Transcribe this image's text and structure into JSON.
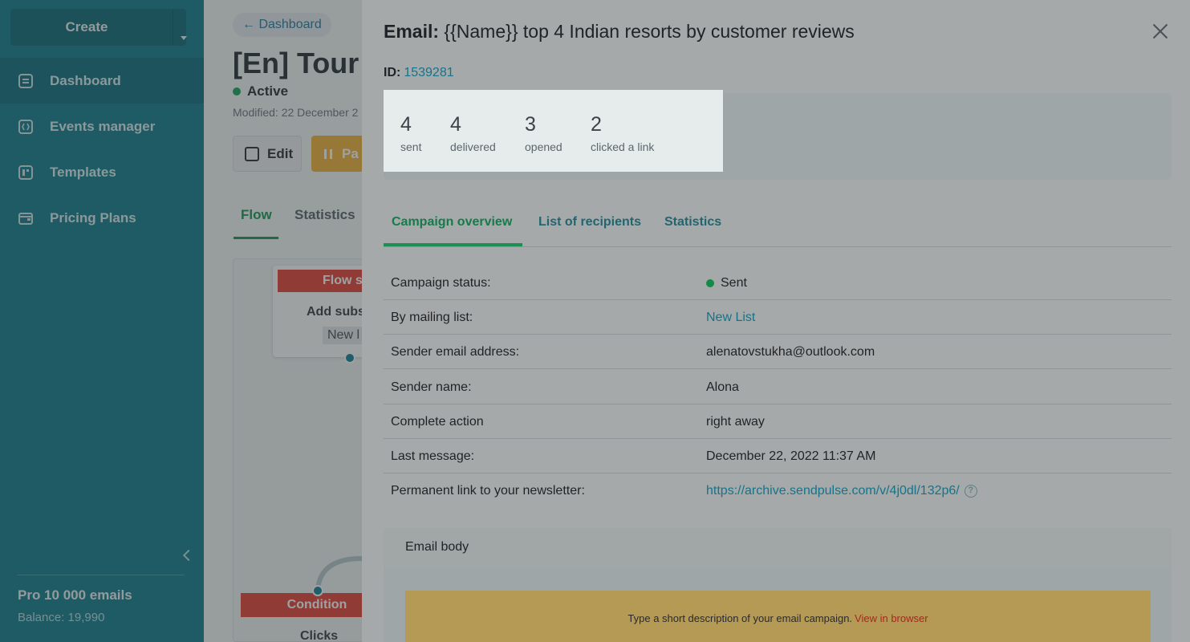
{
  "sidebar": {
    "create_label": "Create",
    "nav": [
      {
        "label": "Dashboard",
        "icon": "dashboard-icon"
      },
      {
        "label": "Events manager",
        "icon": "events-icon"
      },
      {
        "label": "Templates",
        "icon": "templates-icon"
      },
      {
        "label": "Pricing Plans",
        "icon": "wallet-icon"
      }
    ],
    "plan_name": "Pro 10 000 emails",
    "balance": "Balance: 19,990"
  },
  "background": {
    "back_link": "← Dashboard",
    "title": "[En] Tour",
    "status": "Active",
    "modified": "Modified: 22 December 2",
    "edit_label": "Edit",
    "pause_label": "Pa",
    "tabs": [
      "Flow",
      "Statistics"
    ],
    "flow_header": "Flow s",
    "flow_text": "Add subs",
    "flow_chip": "New l",
    "condition_header": "Condition",
    "condition_sub": "Clicks"
  },
  "modal": {
    "title_prefix": "Email:",
    "title": "{{Name}} top 4 Indian resorts by customer reviews",
    "id_label": "ID:",
    "id_value": "1539281",
    "stats": [
      {
        "num": "4",
        "label": "sent"
      },
      {
        "num": "4",
        "label": "delivered"
      },
      {
        "num": "3",
        "label": "opened"
      },
      {
        "num": "2",
        "label": "clicked a link"
      }
    ],
    "tabs": [
      "Campaign overview",
      "List of recipients",
      "Statistics"
    ],
    "rows": [
      {
        "key": "Campaign status:",
        "value": "Sent"
      },
      {
        "key": "By mailing list:",
        "value": "New List"
      },
      {
        "key": "Sender email address:",
        "value": "alenatovstukha@outlook.com"
      },
      {
        "key": "Sender name:",
        "value": "Alona"
      },
      {
        "key": "Complete action",
        "value": "right away"
      },
      {
        "key": "Last message:",
        "value": "December 22, 2022 11:37 AM"
      },
      {
        "key": "Permanent link to your newsletter:",
        "value": "https://archive.sendpulse.com/v/4j0dl/132p6/"
      }
    ],
    "body_label": "Email body",
    "email_desc": "Type a short description of your email campaign.",
    "view_in_browser": "View in browser",
    "help_symbol": "?"
  },
  "colors": {
    "sidebar": "#17808f",
    "accent_green": "#1c9a56",
    "flow_red": "#e8453c",
    "pause_yellow": "#f3b43c"
  }
}
